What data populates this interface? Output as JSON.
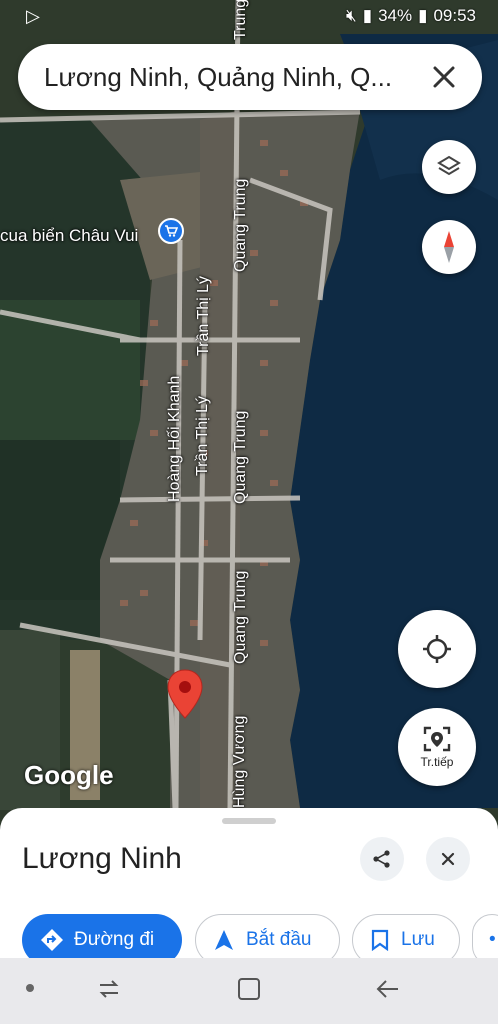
{
  "status_bar": {
    "battery": "34%",
    "time": "09:53"
  },
  "search": {
    "query": "Lương Ninh, Quảng Ninh, Q..."
  },
  "map": {
    "poi_label": "cua biển Châu Vui",
    "streets": [
      "Quang Trung",
      "Trần Thị Lý",
      "Hoàng Hối Khanh",
      "Trần Thị Lý",
      "Quang Trung",
      "Quang Trung",
      "Hùng Vương"
    ],
    "top_street": "Trung",
    "watermark": "Google"
  },
  "controls": {
    "next_label": "Tr.tiếp"
  },
  "sheet": {
    "place_name": "Lương Ninh",
    "directions_label": "Đường đi",
    "start_label": "Bắt đầu",
    "save_label": "Lưu"
  },
  "icons": [
    "layers-icon",
    "compass-icon",
    "my-location-icon",
    "lens-icon",
    "share-icon",
    "close-icon",
    "directions-icon",
    "navigation-icon",
    "bookmark-icon"
  ],
  "colors": {
    "accent": "#1a73e8",
    "pin": "#ea4335",
    "water": "#0d2740"
  }
}
